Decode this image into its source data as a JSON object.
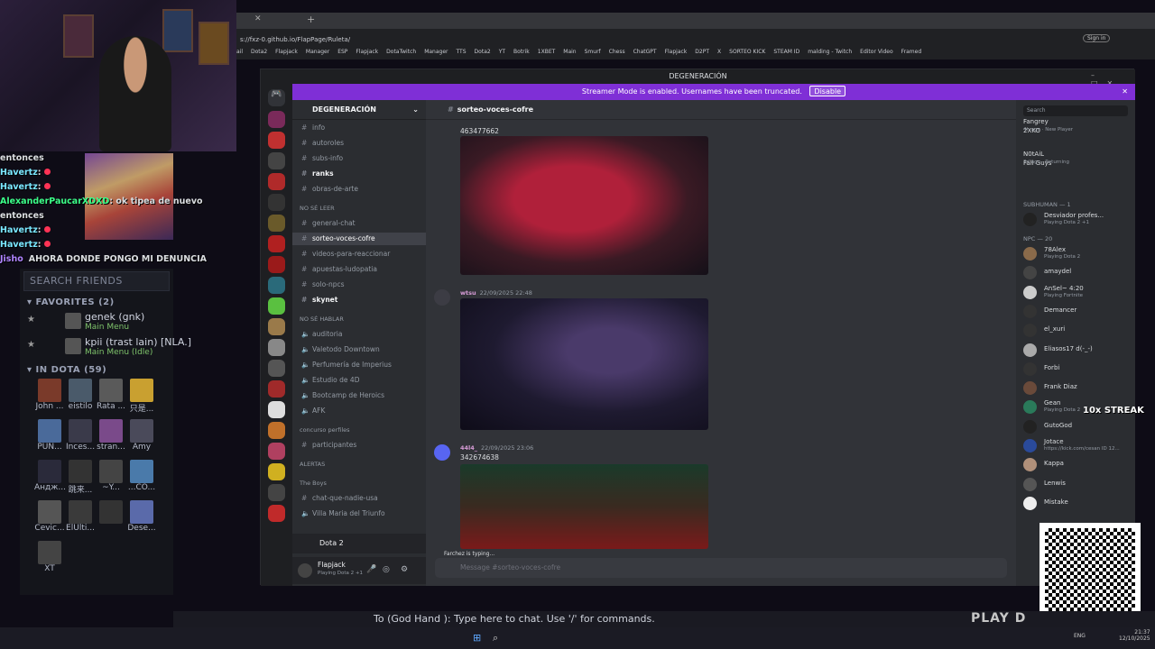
{
  "browser": {
    "url": "s://fxz-0.github.io/FlapPage/Ruleta/",
    "bookmarks": [
      "ail",
      "Dota2",
      "Flapjack",
      "Manager",
      "ESP",
      "Flapjack",
      "DotaTwitch",
      "Manager",
      "TTS",
      "Dota2",
      "YT",
      "Botrik",
      "1XBET",
      "Main",
      "Smurf",
      "Chess",
      "ChatGPT",
      "Flapjack",
      "D2PT",
      "X",
      "SORTEO KICK",
      "STEAM ID",
      "malding - Twitch",
      "Editor Video",
      "Framed"
    ],
    "profile_label": "Sign in"
  },
  "stream_chat": [
    {
      "user": "",
      "text": "entonces"
    },
    {
      "user": "Havertz",
      "text": ":"
    },
    {
      "user": "Havertz",
      "text": ":"
    },
    {
      "user": "AlexanderPaucarXDXD",
      "text": ": ok tipea de nuevo"
    },
    {
      "user": "",
      "text": "entonces"
    },
    {
      "user": "Havertz",
      "text": ":"
    },
    {
      "user": "Havertz",
      "text": ":"
    },
    {
      "user": "Jisho",
      "text": "AHORA DONDE PONGO MI DENUNCIA"
    }
  ],
  "friends": {
    "search_placeholder": "SEARCH FRIENDS",
    "favorites_label": "FAVORITES (2)",
    "favorites": [
      {
        "name": "genek (gnk)",
        "status": "Main Menu"
      },
      {
        "name": "kpii (trast lain) [NLA.]",
        "status": "Main Menu (Idle)"
      }
    ],
    "in_dota_label": "IN DOTA (59)",
    "in_dota": [
      "John ...",
      "eistilo",
      "Rata ...",
      "只是...",
      "PUN...",
      "Inces...",
      "stran...",
      "Amy",
      "Андж...",
      "跳来...",
      "~Y...",
      "...CO...",
      "Cevic...",
      "ElUlti...",
      "",
      "Dese...",
      "XT"
    ]
  },
  "discord": {
    "window_title": "DEGENERACIÓN",
    "banner_text": "Streamer Mode is enabled. Usernames have been truncated.",
    "banner_button": "Disable",
    "guild_name": "DEGENERACIÓN",
    "channels": [
      {
        "label": "info",
        "type": "text"
      },
      {
        "label": "autoroles",
        "type": "text"
      },
      {
        "label": "subs-info",
        "type": "text"
      },
      {
        "label": "ranks",
        "type": "text",
        "bold": true
      },
      {
        "label": "obras-de-arte",
        "type": "text"
      },
      {
        "label": "NO SÉ LEER",
        "type": "category"
      },
      {
        "label": "general-chat",
        "type": "text"
      },
      {
        "label": "sorteo-voces-cofre",
        "type": "text",
        "selected": true
      },
      {
        "label": "videos-para-reaccionar",
        "type": "text"
      },
      {
        "label": "apuestas-ludopatia",
        "type": "text"
      },
      {
        "label": "solo-npcs",
        "type": "text"
      },
      {
        "label": "skynet",
        "type": "text",
        "bold": true
      },
      {
        "label": "NO SÉ HABLAR",
        "type": "category"
      },
      {
        "label": "auditoria",
        "type": "voice"
      },
      {
        "label": "Valetodo Downtown",
        "type": "voice"
      },
      {
        "label": "Perfumería de Imperius",
        "type": "voice"
      },
      {
        "label": "Estudio de 4D",
        "type": "voice"
      },
      {
        "label": "Bootcamp de Heroics",
        "type": "voice"
      },
      {
        "label": "AFK",
        "type": "voice"
      },
      {
        "label": "concurso perfiles",
        "type": "category"
      },
      {
        "label": "participantes",
        "type": "text"
      },
      {
        "label": "ALERTAS",
        "type": "category"
      },
      {
        "label": "The Boys",
        "type": "category"
      },
      {
        "label": "chat-que-nadie-usa",
        "type": "text"
      },
      {
        "label": "Villa Maria del Triunfo",
        "type": "voice"
      }
    ],
    "voice_activity": "Dota 2",
    "user": {
      "name": "Flapjack",
      "status": "Playing Dota 2 +1"
    },
    "channel_header": "sorteo-voces-cofre",
    "search_placeholder": "Search",
    "messages": [
      {
        "author": "",
        "time": "",
        "text": "463477662"
      },
      {
        "author": "wtsu",
        "time": "22/09/2025 22:48",
        "text": ""
      },
      {
        "author": "44l4_",
        "time": "22/09/2025 23:06",
        "text": "342674638"
      }
    ],
    "typing": "Farchez is typing...",
    "input_placeholder": "Message #sorteo-voces-cofre",
    "member_groups": [
      "SUBHUMAN — 1",
      "NPC — 20"
    ],
    "members_top": [
      {
        "name": "Fangrey",
        "status": ""
      },
      {
        "name": "2XKO",
        "status": "4h ago · New Player"
      },
      {
        "name": "N0tAiL",
        "status": ""
      },
      {
        "name": "Fall Guys",
        "status": "3d ago · Returning"
      },
      {
        "name": "Desviador profes...",
        "status": "Playing Dota 2 +1"
      }
    ],
    "members": [
      {
        "name": "78Alex",
        "status": "Playing Dota 2"
      },
      {
        "name": "amaydel",
        "status": ""
      },
      {
        "name": "AnSel~ 4:20",
        "status": "Playing Fortnite"
      },
      {
        "name": "Demancer",
        "status": ""
      },
      {
        "name": "el_xuri",
        "status": ""
      },
      {
        "name": "Eliasos17 d(-_-)",
        "status": ""
      },
      {
        "name": "Forbi",
        "status": ""
      },
      {
        "name": "Frank Diaz",
        "status": ""
      },
      {
        "name": "Gean",
        "status": "Playing Dota 2"
      },
      {
        "name": "GutoGod",
        "status": ""
      },
      {
        "name": "Jotace",
        "status": "https://kick.com/cesan ID 12..."
      },
      {
        "name": "Kappa",
        "status": ""
      },
      {
        "name": "Lenwis",
        "status": ""
      },
      {
        "name": "Mistake",
        "status": ""
      }
    ]
  },
  "overlay": {
    "streak": "10x STREAK",
    "dota_chat_prompt": "To (God Hand ): Type here to chat. Use '/' for commands.",
    "play_button": "PLAY D"
  },
  "taskbar": {
    "lang": "ENG",
    "time": "21:37",
    "date": "12/10/2025"
  }
}
